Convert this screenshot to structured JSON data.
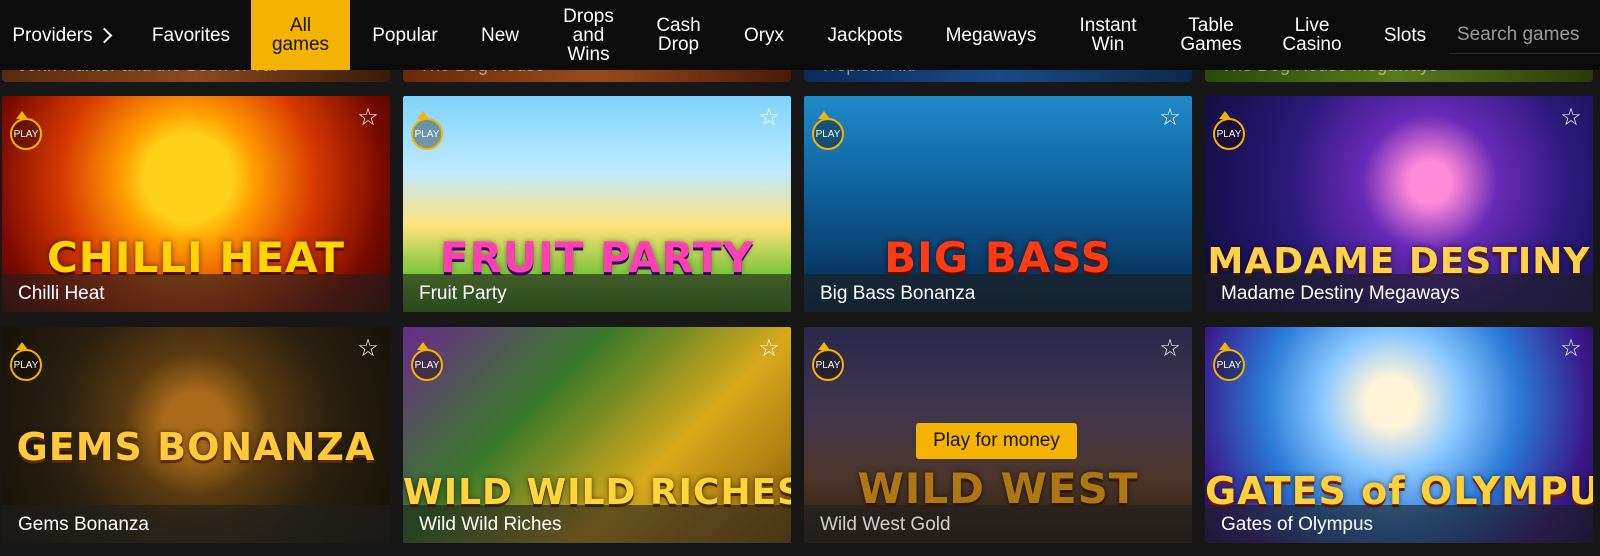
{
  "nav": {
    "items": [
      {
        "label": "Providers",
        "active": false
      },
      {
        "label": "Favorites",
        "active": false
      },
      {
        "label": "All\ngames",
        "active": true
      },
      {
        "label": "Popular",
        "active": false
      },
      {
        "label": "New",
        "active": false
      },
      {
        "label": "Drops\nand\nWins",
        "active": false
      },
      {
        "label": "Cash\nDrop",
        "active": false
      },
      {
        "label": "Oryx",
        "active": false
      },
      {
        "label": "Jackpots",
        "active": false
      },
      {
        "label": "Megaways",
        "active": false
      },
      {
        "label": "Instant\nWin",
        "active": false
      },
      {
        "label": "Table\nGames",
        "active": false
      },
      {
        "label": "Live\nCasino",
        "active": false
      },
      {
        "label": "Slots",
        "active": false
      }
    ],
    "search_placeholder": "Search games"
  },
  "ghost_row": [
    "John Hunter and the Book of Tut",
    "The Dog House",
    "Tropical Tiki",
    "The Dog House Megaways"
  ],
  "games": [
    {
      "title": "Chilli Heat",
      "logo": "CHILLI HEAT",
      "play_badge": "PLAY"
    },
    {
      "title": "Fruit Party",
      "logo": "FRUIT PARTY",
      "play_badge": "PLAY"
    },
    {
      "title": "Big Bass Bonanza",
      "logo": "BIG BASS",
      "play_badge": "PLAY"
    },
    {
      "title": "Madame Destiny Megaways",
      "logo": "MADAME DESTINY",
      "play_badge": "PLAY"
    },
    {
      "title": "Gems Bonanza",
      "logo": "GEMS BONANZA",
      "play_badge": "PLAY"
    },
    {
      "title": "Wild Wild Riches",
      "logo": "WILD WILD RICHES",
      "play_badge": "PLAY"
    },
    {
      "title": "Wild West Gold",
      "logo": "WILD WEST",
      "play_badge": "PLAY",
      "hover_button": "Play for money"
    },
    {
      "title": "Gates of Olympus",
      "logo": "GATES of OLYMPUS",
      "play_badge": "PLAY"
    }
  ],
  "colors": {
    "accent": "#f3b300",
    "nav_bg": "#0c0c0c",
    "page_bg": "#171717"
  }
}
